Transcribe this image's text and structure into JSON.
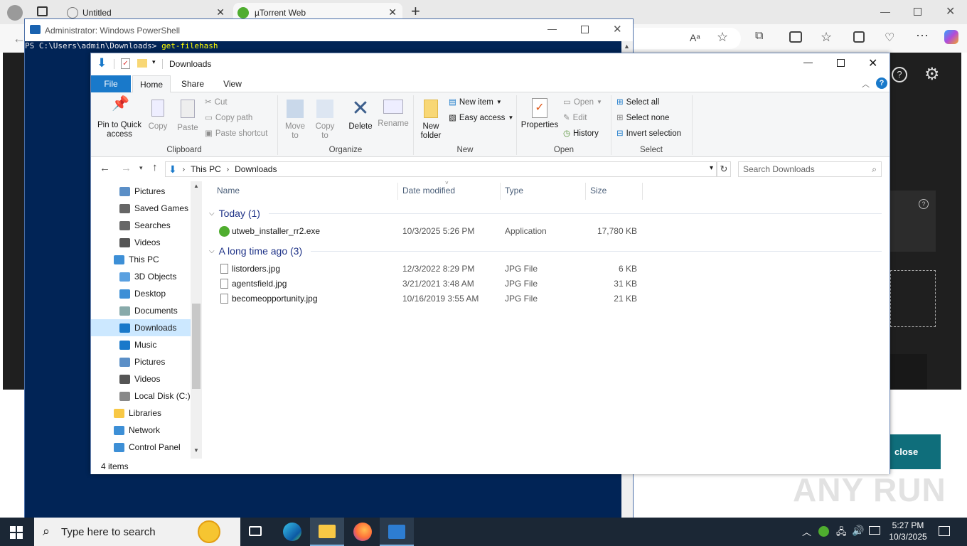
{
  "browser": {
    "tabs": [
      {
        "title": "Untitled"
      },
      {
        "title": "µTorrent Web"
      }
    ],
    "close_label": "close"
  },
  "powershell": {
    "title": "Administrator: Windows PowerShell",
    "prompt": "PS C:\\Users\\admin\\Downloads> ",
    "command": "get-filehash"
  },
  "explorer": {
    "title": "Downloads",
    "ribbon_tabs": [
      "File",
      "Home",
      "Share",
      "View"
    ],
    "clipboard": {
      "pin": "Pin to Quick access",
      "copy": "Copy",
      "paste": "Paste",
      "cut": "Cut",
      "copy_path": "Copy path",
      "paste_shortcut": "Paste shortcut",
      "label": "Clipboard"
    },
    "organize": {
      "move_to": "Move to",
      "copy_to": "Copy to",
      "delete": "Delete",
      "rename": "Rename",
      "label": "Organize"
    },
    "new": {
      "new_folder": "New folder",
      "new_item": "New item",
      "easy_access": "Easy access",
      "label": "New"
    },
    "open": {
      "properties": "Properties",
      "open": "Open",
      "edit": "Edit",
      "history": "History",
      "label": "Open"
    },
    "select": {
      "select_all": "Select all",
      "select_none": "Select none",
      "invert": "Invert selection",
      "label": "Select"
    },
    "breadcrumb": [
      "This PC",
      "Downloads"
    ],
    "search_placeholder": "Search Downloads",
    "nav_items": [
      {
        "label": "Pictures",
        "icon": "pictures-icon",
        "level": 2
      },
      {
        "label": "Saved Games",
        "icon": "saved-games-icon",
        "level": 2
      },
      {
        "label": "Searches",
        "icon": "searches-icon",
        "level": 2
      },
      {
        "label": "Videos",
        "icon": "videos-icon",
        "level": 2
      },
      {
        "label": "This PC",
        "icon": "this-pc-icon",
        "level": 1
      },
      {
        "label": "3D Objects",
        "icon": "3d-objects-icon",
        "level": 2
      },
      {
        "label": "Desktop",
        "icon": "desktop-icon",
        "level": 2
      },
      {
        "label": "Documents",
        "icon": "documents-icon",
        "level": 2
      },
      {
        "label": "Downloads",
        "icon": "downloads-icon",
        "level": 2,
        "selected": true
      },
      {
        "label": "Music",
        "icon": "music-icon",
        "level": 2
      },
      {
        "label": "Pictures",
        "icon": "pictures-icon",
        "level": 2
      },
      {
        "label": "Videos",
        "icon": "videos-icon",
        "level": 2
      },
      {
        "label": "Local Disk (C:)",
        "icon": "local-disk-icon",
        "level": 2
      },
      {
        "label": "Libraries",
        "icon": "libraries-icon",
        "level": 1
      },
      {
        "label": "Network",
        "icon": "network-icon",
        "level": 1
      },
      {
        "label": "Control Panel",
        "icon": "control-panel-icon",
        "level": 1
      }
    ],
    "columns": [
      "Name",
      "Date modified",
      "Type",
      "Size"
    ],
    "groups": [
      {
        "label": "Today (1)",
        "files": [
          {
            "name": "utweb_installer_rr2.exe",
            "date": "10/3/2025 5:26 PM",
            "type": "Application",
            "size": "17,780 KB",
            "icon": "utorrent-icon"
          }
        ]
      },
      {
        "label": "A long time ago (3)",
        "files": [
          {
            "name": "listorders.jpg",
            "date": "12/3/2022 8:29 PM",
            "type": "JPG File",
            "size": "6 KB",
            "icon": "jpg-file-icon"
          },
          {
            "name": "agentsfield.jpg",
            "date": "3/21/2021 3:48 AM",
            "type": "JPG File",
            "size": "31 KB",
            "icon": "jpg-file-icon"
          },
          {
            "name": "becomeopportunity.jpg",
            "date": "10/16/2019 3:55 AM",
            "type": "JPG File",
            "size": "21 KB",
            "icon": "jpg-file-icon"
          }
        ]
      }
    ],
    "status": "4 items"
  },
  "taskbar": {
    "search_placeholder": "Type here to search",
    "time": "5:27 PM",
    "date": "10/3/2025"
  },
  "watermark": "ANY RUN",
  "colors": {
    "accent": "#1979ca",
    "ps_bg": "#012456",
    "selected": "#cce8ff",
    "group": "#1e3287",
    "teal_button": "#0f6e7b"
  }
}
